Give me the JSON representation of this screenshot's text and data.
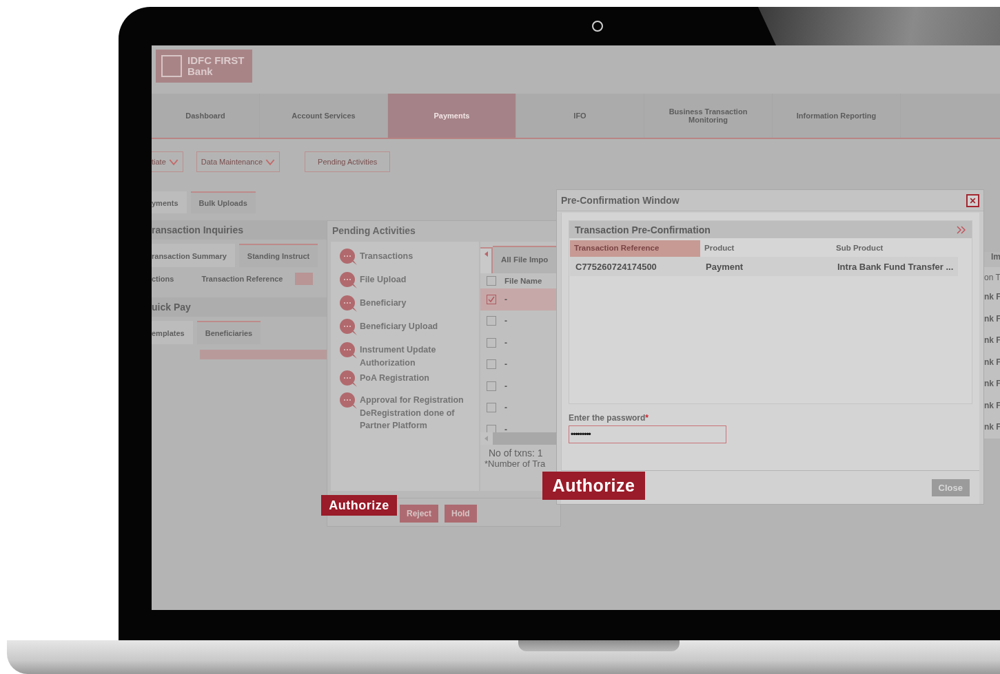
{
  "logo": {
    "line1": "IDFC FIRST",
    "line2": "Bank"
  },
  "nav_tabs": [
    {
      "label": "Dashboard",
      "selected": false
    },
    {
      "label": "Account Services",
      "selected": false
    },
    {
      "label": "Payments",
      "selected": true
    },
    {
      "label": "IFO",
      "selected": false
    },
    {
      "label": "Business Transaction Monitoring",
      "selected": false
    },
    {
      "label": "Information Reporting",
      "selected": false
    }
  ],
  "toolbar": [
    {
      "label": "tiate",
      "kind": "dropdown"
    },
    {
      "label": "Data Maintenance",
      "kind": "dropdown"
    },
    {
      "label": "Pending Activities",
      "kind": "button"
    }
  ],
  "payment_tabs": [
    {
      "label": "yments",
      "selected": true
    },
    {
      "label": "Bulk Uploads",
      "selected": false
    }
  ],
  "inquiries": {
    "title": "ransaction Inquiries",
    "tabs": [
      {
        "label": "ransaction Summary",
        "selected": true
      },
      {
        "label": "Standing Instruct",
        "selected": false
      }
    ],
    "columns": [
      "ctions",
      "Transaction Reference"
    ]
  },
  "quick_pay": {
    "title": "uick Pay",
    "tabs": [
      {
        "label": "emplates",
        "selected": true
      },
      {
        "label": "Beneficiaries",
        "selected": false
      }
    ]
  },
  "pending": {
    "title": "Pending Activities",
    "items": [
      "Transactions",
      "File Upload",
      "Beneficiary",
      "Beneficiary Upload",
      "Instrument Update Authorization",
      "PoA Registration",
      "Approval for Registration DeRegistration done of Partner Platform"
    ],
    "file_panel": {
      "tab": "All File Impo",
      "header_checked": false,
      "column": "File Name",
      "rows": [
        {
          "checked": true,
          "cell": "-"
        },
        {
          "checked": false,
          "cell": "-"
        },
        {
          "checked": false,
          "cell": "-"
        },
        {
          "checked": false,
          "cell": "-"
        },
        {
          "checked": false,
          "cell": "-"
        },
        {
          "checked": false,
          "cell": "-"
        },
        {
          "checked": false,
          "cell": "-"
        }
      ],
      "count": "No of txns: 1",
      "note": "*Number of Tra"
    },
    "authorize": "Authorize",
    "buttons": [
      "Reject",
      "Hold"
    ]
  },
  "background_column": {
    "header": "Im",
    "cells": [
      "on T",
      "nk F",
      "nk F",
      "nk F",
      "nk F",
      "nk F",
      "nk F",
      "nk F"
    ]
  },
  "modal": {
    "title": "Pre-Confirmation Window",
    "section": "Transaction Pre-Confirmation",
    "columns": [
      {
        "label": "Transaction Reference",
        "sorted": true
      },
      {
        "label": "Product",
        "sorted": false
      },
      {
        "label": "Sub Product",
        "sorted": false
      }
    ],
    "rows": [
      [
        "C775260724174500",
        "Payment",
        "Intra Bank Fund Transfer ..."
      ]
    ],
    "password_label": "Enter the password",
    "required_mark": "*",
    "password_value": "•••••••••",
    "authorize": "Authorize",
    "close": "Close"
  }
}
